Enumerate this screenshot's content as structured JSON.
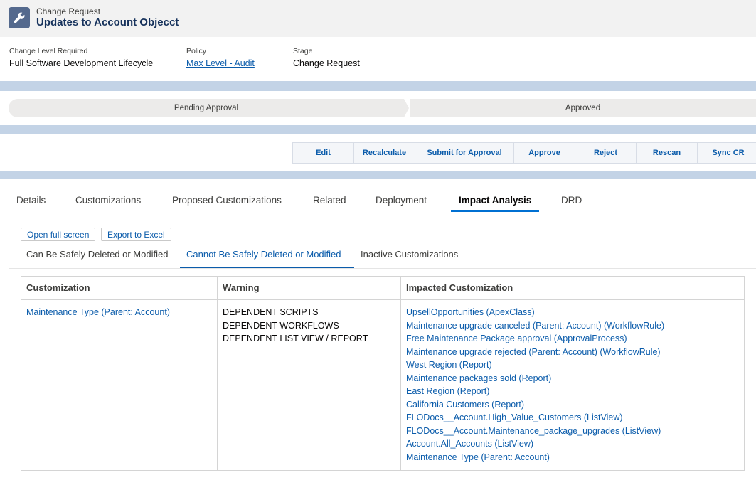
{
  "header": {
    "icon": "wrench-icon",
    "object_type": "Change Request",
    "title": "Updates to Account Objecct"
  },
  "fields": [
    {
      "label": "Change Level Required",
      "value": "Full Software Development Lifecycle"
    },
    {
      "label": "Policy",
      "value": "Max Level - Audit"
    },
    {
      "label": "Stage",
      "value": "Change Request"
    }
  ],
  "path": [
    "Pending Approval",
    "Approved"
  ],
  "actions": [
    "Edit",
    "Recalculate",
    "Submit for Approval",
    "Approve",
    "Reject",
    "Rescan",
    "Sync CR"
  ],
  "tabs": [
    "Details",
    "Customizations",
    "Proposed Customizations",
    "Related",
    "Deployment",
    "Impact Analysis",
    "DRD"
  ],
  "active_tab": "Impact Analysis",
  "toolbar": {
    "open_full_screen": "Open full screen",
    "export_excel": "Export to Excel"
  },
  "subtabs": [
    "Can Be Safely Deleted or Modified",
    "Cannot Be Safely Deleted or Modified",
    "Inactive Customizations"
  ],
  "active_subtab": "Cannot Be Safely Deleted or Modified",
  "table": {
    "headers": [
      "Customization",
      "Warning",
      "Impacted Customization"
    ],
    "customization": "Maintenance Type (Parent: Account)",
    "warnings": [
      "DEPENDENT SCRIPTS",
      "DEPENDENT WORKFLOWS",
      "DEPENDENT LIST VIEW / REPORT"
    ],
    "impacted": [
      "UpsellOpportunities (ApexClass)",
      "Maintenance upgrade canceled (Parent: Account) (WorkflowRule)",
      "Free Maintenance Package approval (ApprovalProcess)",
      "Maintenance upgrade rejected (Parent: Account) (WorkflowRule)",
      "West Region (Report)",
      "Maintenance packages sold (Report)",
      "East Region (Report)",
      "California Customers (Report)",
      "FLODocs__Account.High_Value_Customers (ListView)",
      "FLODocs__Account.Maintenance_package_upgrades (ListView)",
      "Account.All_Accounts (ListView)",
      "Maintenance Type (Parent: Account)"
    ]
  },
  "colors": {
    "link": "#0b5cab",
    "accent": "#0070d2",
    "header_icon_bg": "#54698d",
    "band": "#c3d3e6"
  }
}
